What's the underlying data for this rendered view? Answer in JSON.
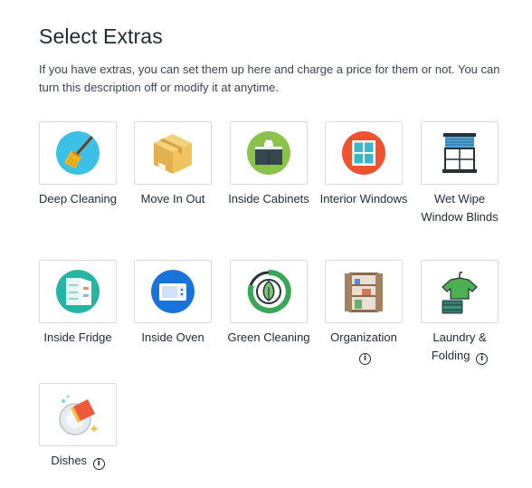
{
  "page": {
    "title": "Select Extras",
    "description": "If you have extras, you can set them up here and charge a price for them or not. You can turn this description off or modify it at anytime."
  },
  "extras": [
    {
      "label": "Deep Cleaning",
      "icon": "broom-icon",
      "info": false
    },
    {
      "label": "Move In Out",
      "icon": "moving-box-icon",
      "info": false
    },
    {
      "label": "Inside Cabinets",
      "icon": "cabinet-icon",
      "info": false
    },
    {
      "label": "Interior Windows",
      "icon": "window-icon",
      "info": false
    },
    {
      "label": "Wet Wipe Window Blinds",
      "icon": "window-blinds-icon",
      "info": false
    },
    {
      "label": "Inside Fridge",
      "icon": "fridge-icon",
      "info": false
    },
    {
      "label": "Inside Oven",
      "icon": "oven-icon",
      "info": false
    },
    {
      "label": "Green Cleaning",
      "icon": "eco-leaf-icon",
      "info": false
    },
    {
      "label": "Organization",
      "icon": "wardrobe-icon",
      "info": true
    },
    {
      "label": "Laundry & Folding",
      "icon": "laundry-shirt-icon",
      "info": true
    },
    {
      "label": "Dishes",
      "icon": "dish-sponge-icon",
      "info": true
    }
  ],
  "info_glyph": "i"
}
